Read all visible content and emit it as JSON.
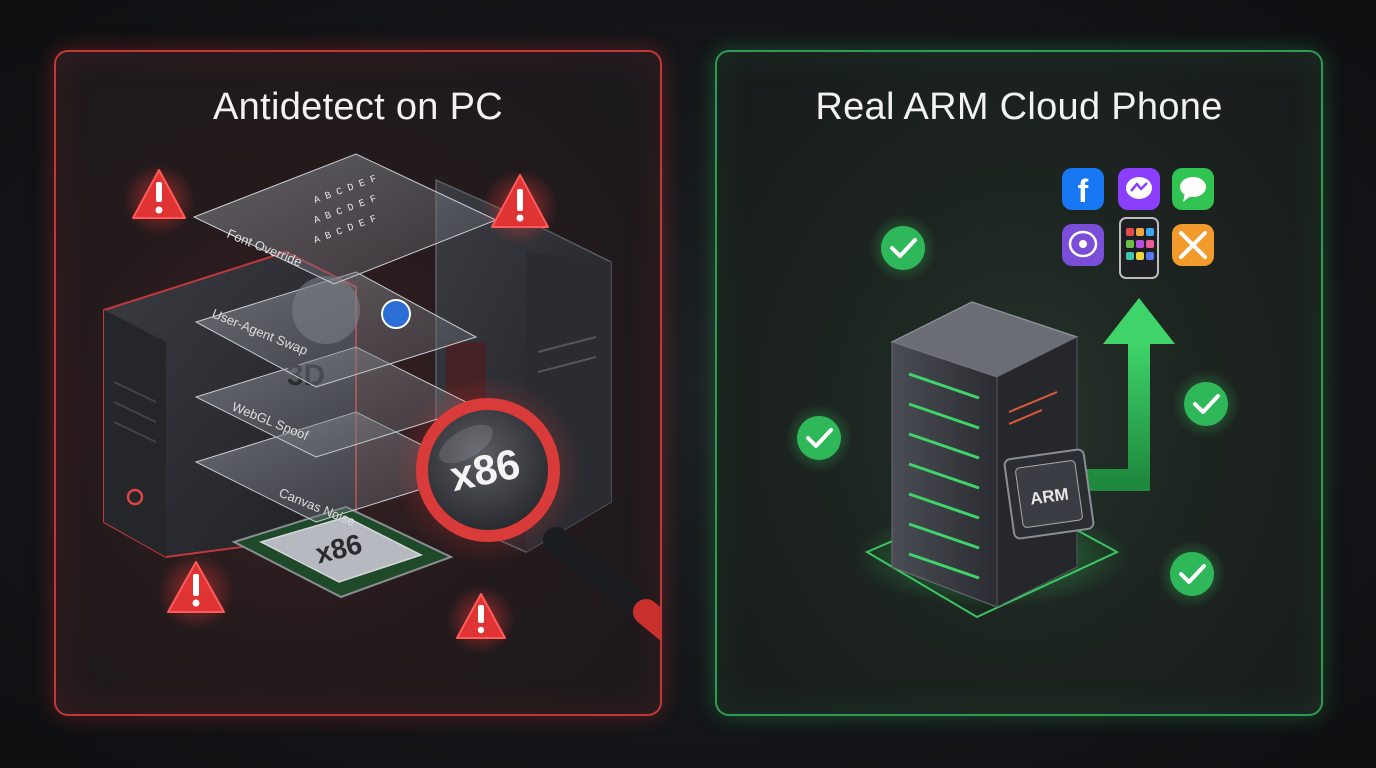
{
  "left_panel": {
    "title": "Antidetect on PC",
    "layers": [
      "Font Override",
      "User-Agent Swap",
      "WebGL Spoof",
      "Canvas Noise"
    ],
    "webgl_badge": "3D",
    "chip_label": "x86",
    "magnifier_label": "x86",
    "font_grid": "A B C D E F",
    "accent_color": "#d93a3a"
  },
  "right_panel": {
    "title": "Real ARM Cloud Phone",
    "chip_label": "ARM",
    "apps": [
      "facebook-icon",
      "messenger-icon",
      "messages-icon",
      "viber-icon",
      "phone-icon",
      "tools-icon"
    ],
    "accent_color": "#2fb85a"
  }
}
